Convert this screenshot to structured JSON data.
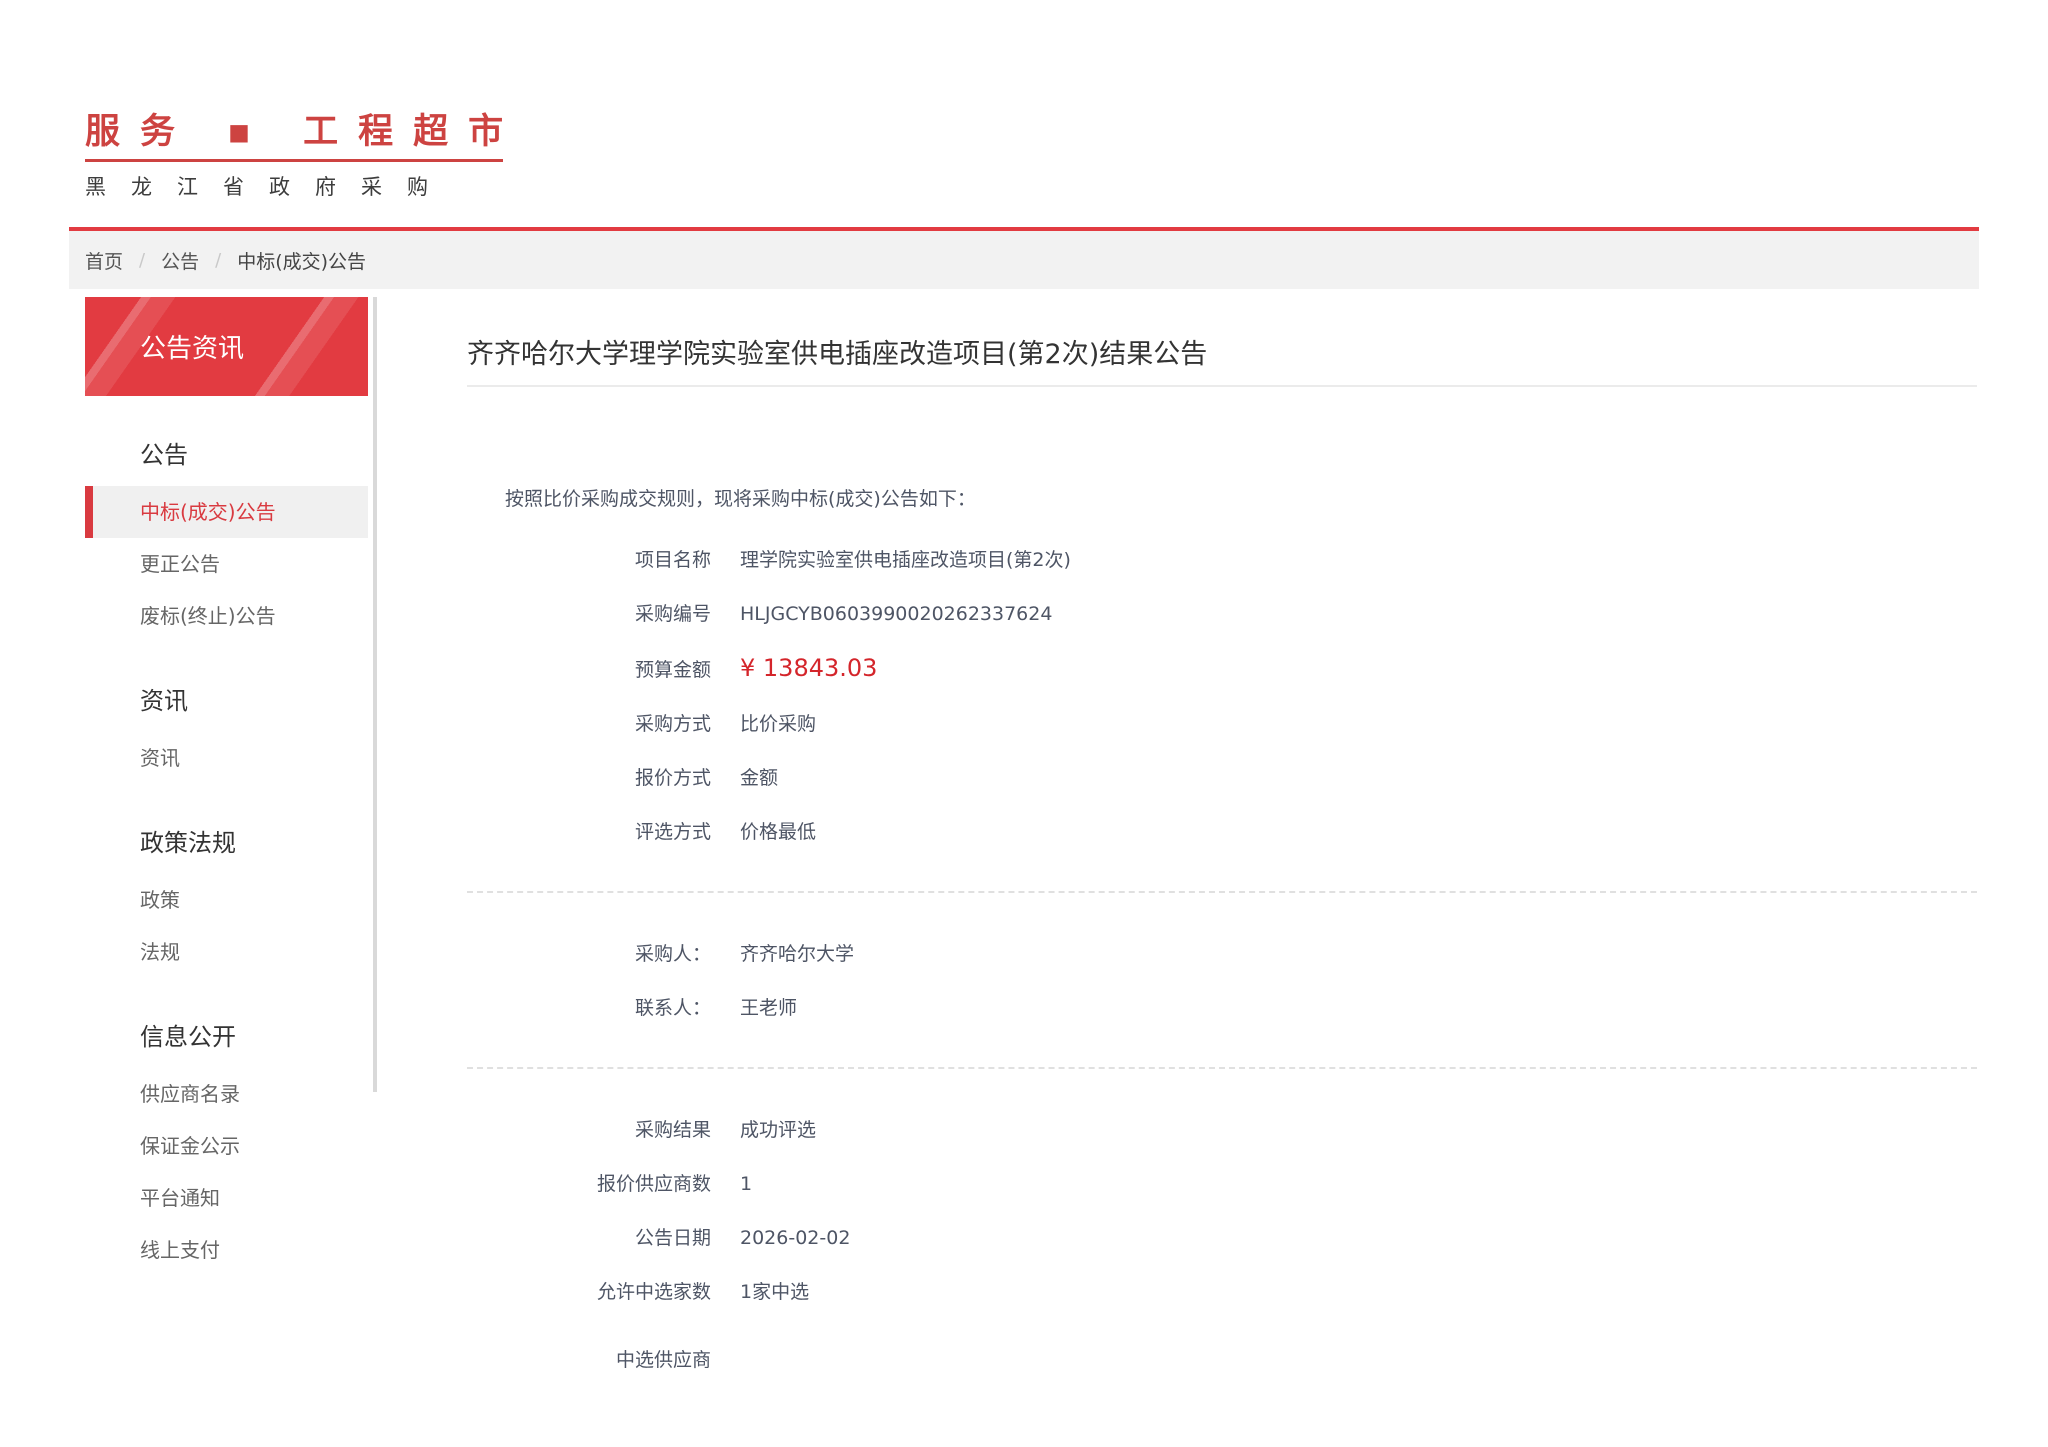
{
  "brand": {
    "logo": "服务 ▪ 工程超市",
    "subtitle": "黑龙江省政府采购"
  },
  "breadcrumb": {
    "separator": "/",
    "items": [
      {
        "label": "首页"
      },
      {
        "label": "公告"
      },
      {
        "label": "中标(成交)公告"
      }
    ]
  },
  "sidebar": {
    "header": "公告资讯",
    "groups": [
      {
        "title": "公告",
        "items": [
          {
            "label": "中标(成交)公告",
            "active": true
          },
          {
            "label": "更正公告"
          },
          {
            "label": "废标(终止)公告"
          }
        ]
      },
      {
        "title": "资讯",
        "items": [
          {
            "label": "资讯"
          }
        ]
      },
      {
        "title": "政策法规",
        "items": [
          {
            "label": "政策"
          },
          {
            "label": "法规"
          }
        ]
      },
      {
        "title": "信息公开",
        "items": [
          {
            "label": "供应商名录"
          },
          {
            "label": "保证金公示"
          },
          {
            "label": "平台通知"
          },
          {
            "label": "线上支付"
          }
        ]
      }
    ]
  },
  "main": {
    "title": "齐齐哈尔大学理学院实验室供电插座改造项目(第2次)结果公告",
    "intro": "按照比价采购成交规则，现将采购中标(成交)公告如下：",
    "basic_fields": [
      {
        "label": "项目名称",
        "value": "理学院实验室供电插座改造项目(第2次)"
      },
      {
        "label": "采购编号",
        "value": "HLJGCYB0603990020262337624"
      },
      {
        "label": "预算金额",
        "value": "¥ 13843.03"
      },
      {
        "label": "采购方式",
        "value": "比价采购"
      },
      {
        "label": "报价方式",
        "value": "金额"
      },
      {
        "label": "评选方式",
        "value": "价格最低"
      }
    ],
    "contact_fields": [
      {
        "label": "采购人：",
        "value": "齐齐哈尔大学"
      },
      {
        "label": "联系人：",
        "value": "王老师"
      }
    ],
    "result_fields": [
      {
        "label": "采购结果",
        "value": "成功评选"
      },
      {
        "label": "报价供应商数",
        "value": "1"
      },
      {
        "label": "公告日期",
        "value": "2026-02-02"
      },
      {
        "label": "允许中选家数",
        "value": "1家中选"
      },
      {
        "label": "中选供应商",
        "value": ""
      }
    ]
  },
  "colors": {
    "brand_red": "#cd4341",
    "accent_red": "#e23b41",
    "active_item_red": "#d93a40",
    "budget_red": "#d4252b",
    "breadcrumb_bg": "#f2f2f2"
  }
}
